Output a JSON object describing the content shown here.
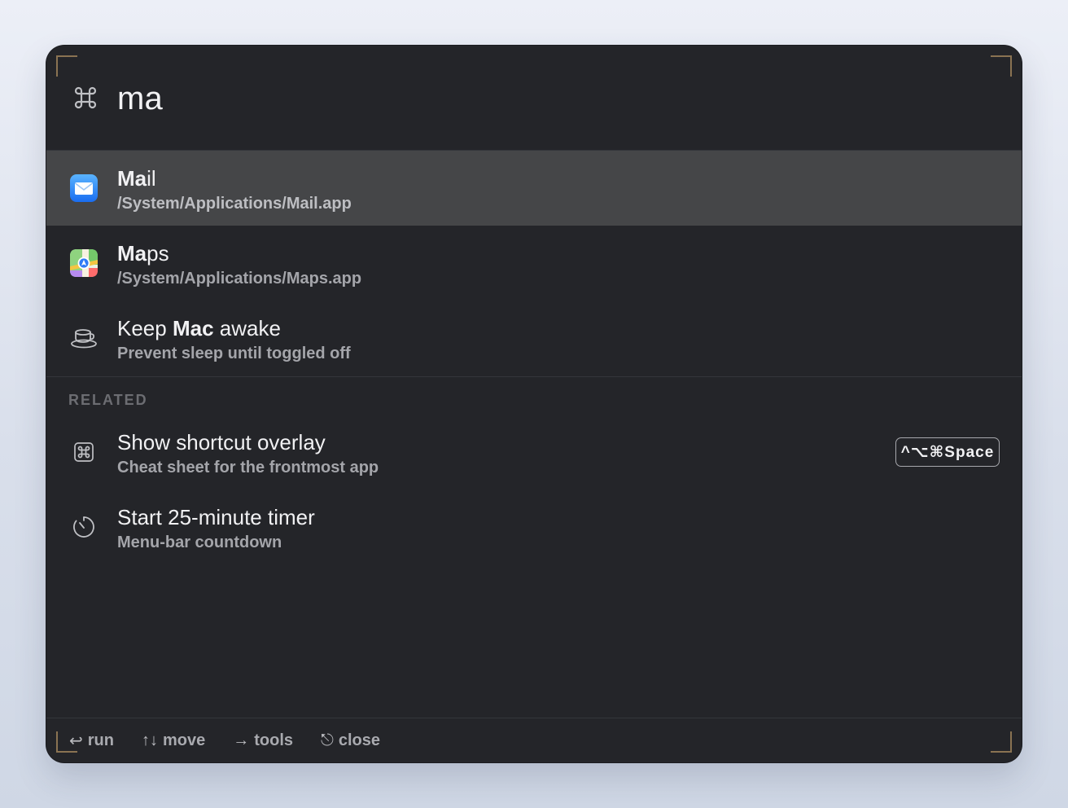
{
  "search": {
    "query": "ma",
    "icon": "command-icon"
  },
  "results": [
    {
      "title_match": "Ma",
      "title_rest": "il",
      "subtitle": "/System/Applications/Mail.app",
      "icon": "mail-app-icon",
      "selected": true
    },
    {
      "title_match": "Ma",
      "title_rest": "ps",
      "subtitle": "/System/Applications/Maps.app",
      "icon": "maps-app-icon",
      "selected": false
    },
    {
      "title_before": "Keep ",
      "title_match": "Mac",
      "title_after": " awake",
      "subtitle": "Prevent sleep until toggled off",
      "icon": "coffee-cup-icon",
      "selected": false
    }
  ],
  "related": {
    "label": "RELATED",
    "items": [
      {
        "title": "Show shortcut overlay",
        "subtitle": "Cheat sheet for the frontmost app",
        "icon": "command-key-icon",
        "shortcut": "^⌥⌘Space"
      },
      {
        "title": "Start 25-minute timer",
        "subtitle": "Menu-bar countdown",
        "icon": "timer-icon"
      }
    ]
  },
  "footer": {
    "run": {
      "glyph": "↩",
      "label": "run"
    },
    "move": {
      "glyph": "↑↓",
      "label": "move"
    },
    "tools": {
      "glyph": "→",
      "label": "tools"
    },
    "close": {
      "glyph": "⎋",
      "label": "close"
    }
  },
  "colors": {
    "panel": "#242529",
    "selected_row": "#454648",
    "corner_accent": "#8a7352"
  }
}
